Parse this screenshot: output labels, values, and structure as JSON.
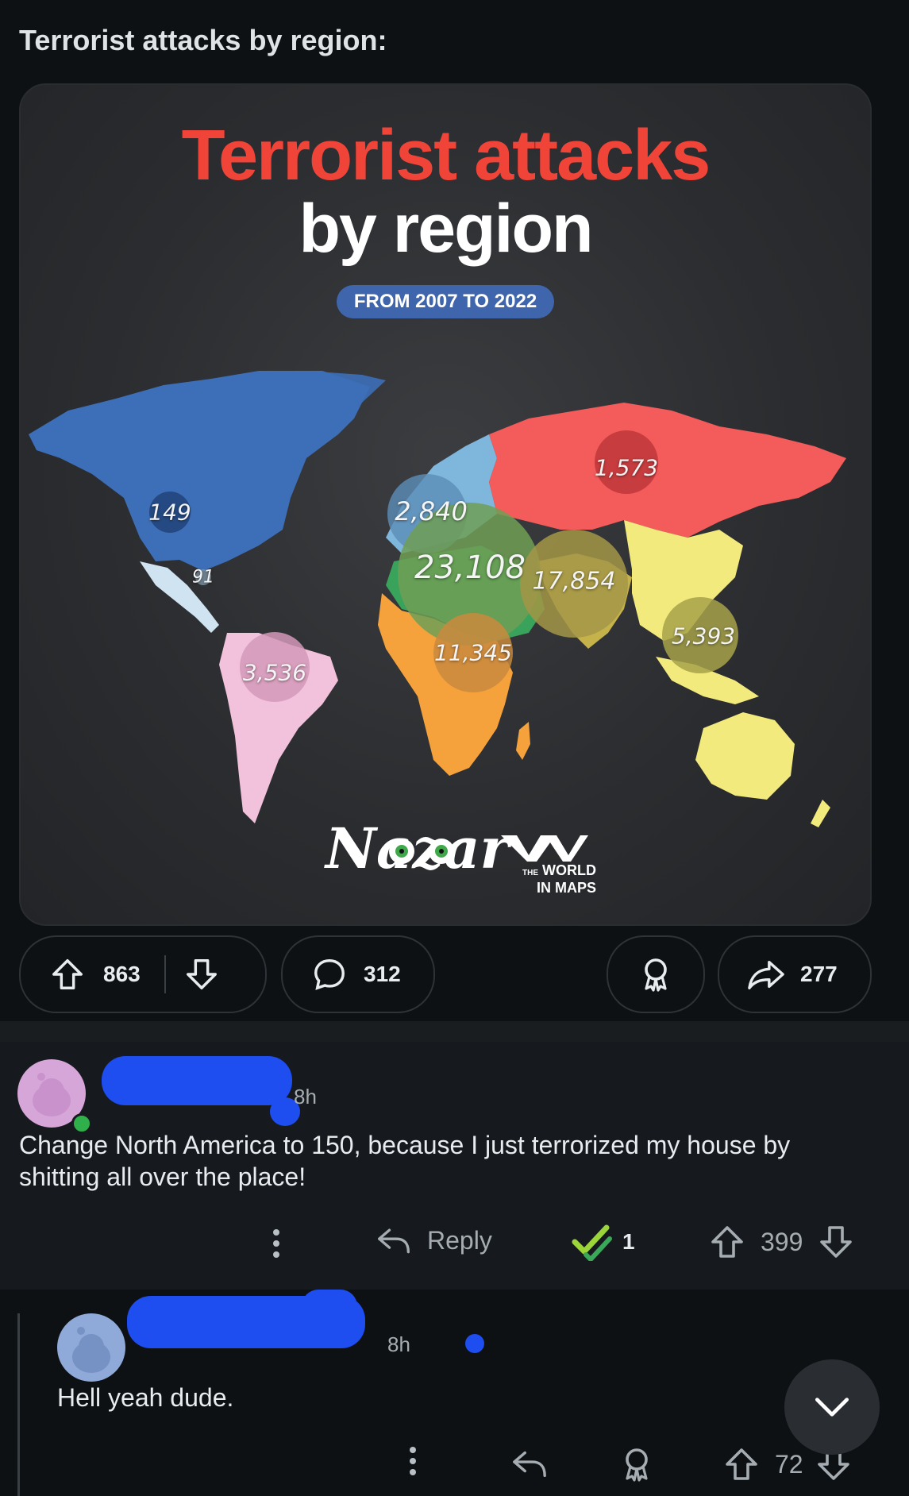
{
  "post": {
    "title": "Terrorist attacks by region:"
  },
  "infographic": {
    "title_line1": "Terrorist attacks",
    "title_line2": "by region",
    "subtitle": "FROM 2007 TO 2022",
    "brand_left": "Nazar",
    "brand_right_small": "THE",
    "brand_right_line1": "WORLD",
    "brand_right_line2": "IN MAPS",
    "regions": [
      {
        "name": "North America",
        "value": "149",
        "color": "#3d6fb8"
      },
      {
        "name": "Central America",
        "value": "91",
        "color": "#cfe3f0"
      },
      {
        "name": "South America",
        "value": "3,536",
        "color": "#f2c2dc"
      },
      {
        "name": "Europe",
        "value": "2,840",
        "color": "#7fb6dc"
      },
      {
        "name": "Russia",
        "value": "1,573",
        "color": "#f45b5b"
      },
      {
        "name": "Middle East",
        "value": "23,108",
        "color": "#3aa35b"
      },
      {
        "name": "South Asia",
        "value": "17,854",
        "color": "#c6b24a"
      },
      {
        "name": "Africa",
        "value": "11,345",
        "color": "#f5a23c"
      },
      {
        "name": "Southeast Asia & Oceania",
        "value": "5,393",
        "color": "#f3ea7d"
      }
    ]
  },
  "actions": {
    "upvotes": "863",
    "comments": "312",
    "shares": "277"
  },
  "comments": [
    {
      "time": "8h",
      "text": "Change North America to 150, because I just terrorized my house by shitting all over the place!",
      "reply_label": "Reply",
      "award_count": "1",
      "votes": "399"
    },
    {
      "time": "8h",
      "text": "Hell yeah dude.",
      "votes": "72"
    }
  ]
}
